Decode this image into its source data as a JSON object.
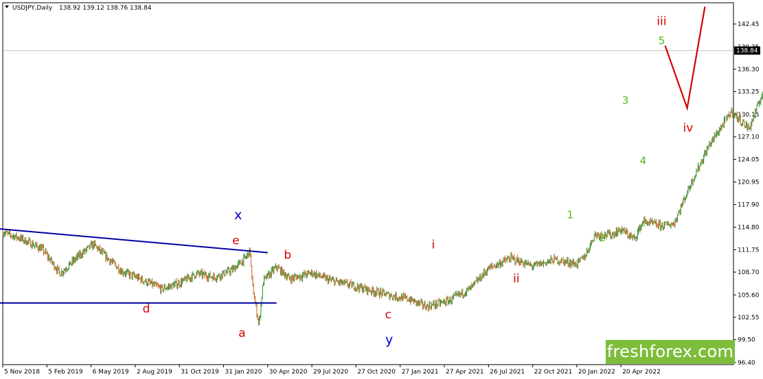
{
  "header": {
    "symbol": "USDJPY,Daily",
    "ohlc": "138.92 139.12 138.76 138.84"
  },
  "brand": {
    "text": "freshforex.com",
    "color": "#7dbd3b"
  },
  "colors": {
    "bull_candle": "#2e8b2e",
    "bear_candle": "#c8641e",
    "trendline": "#0000a0",
    "forecast": "#d40000",
    "wave_red": "#d40000",
    "wave_blue": "#0000c8",
    "wave_green": "#4cbb17",
    "price_line": "#c0c0c0"
  },
  "chart_data": {
    "type": "line",
    "title": "USDJPY,Daily",
    "xlabel": "",
    "ylabel": "",
    "ylim": [
      95.5,
      145.0
    ],
    "grid": false,
    "y_ticks": [
      "142.45",
      "139.35",
      "136.30",
      "133.25",
      "130.15",
      "127.10",
      "124.05",
      "120.95",
      "117.90",
      "114.80",
      "111.75",
      "108.70",
      "105.60",
      "102.55",
      "99.50",
      "96.40"
    ],
    "x_ticks": [
      "5 Nov 2018",
      "5 Feb 2019",
      "6 May 2019",
      "2 Aug 2019",
      "31 Oct 2019",
      "31 Jan 2020",
      "30 Apr 2020",
      "29 Jul 2020",
      "27 Oct 2020",
      "27 Jan 2021",
      "27 Apr 2021",
      "26 Jul 2021",
      "22 Oct 2021",
      "20 Jan 2022",
      "20 Apr 2022"
    ],
    "current_price": {
      "value": 138.84,
      "label": "138.84"
    },
    "series": [
      {
        "values_t": [
          0,
          0.4,
          0.9,
          1.3,
          1.7,
          2.05,
          2.3,
          2.7,
          3.1,
          3.6,
          4.0,
          4.4,
          4.8,
          5.2,
          5.5,
          5.6,
          5.65,
          5.8,
          5.9,
          6.2,
          6.5,
          7.0,
          7.4,
          7.9,
          8.4,
          8.8,
          9.2,
          9.6,
          10.1,
          10.6,
          11.0,
          11.5,
          12.0,
          12.5,
          13.0,
          13.2,
          13.4,
          13.8,
          14.0,
          14.3,
          14.5,
          14.9,
          15.2,
          15.6,
          16.0,
          16.5,
          16.9,
          17.3,
          17.7,
          18.1,
          18.4
        ],
        "values_price": [
          114.1,
          113.3,
          111.8,
          108.5,
          110.8,
          112.5,
          111.0,
          108.8,
          107.8,
          106.4,
          107.2,
          108.5,
          108.0,
          109.0,
          110.6,
          111.7,
          107.0,
          101.5,
          107.5,
          109.4,
          107.8,
          108.6,
          107.6,
          106.9,
          106.1,
          105.5,
          105.0,
          104.0,
          104.8,
          106.5,
          109.2,
          110.6,
          109.5,
          110.4,
          109.8,
          111.0,
          113.8,
          113.8,
          114.5,
          113.2,
          115.6,
          115.0,
          115.3,
          121.0,
          126.0,
          130.5,
          128.2,
          134.5,
          136.2,
          138.0,
          138.84
        ]
      }
    ],
    "trendlines": [
      {
        "t1": -0.1,
        "p1": 114.6,
        "t2": 6.0,
        "p2": 111.35
      },
      {
        "t1": -0.1,
        "p1": 104.5,
        "t2": 6.2,
        "p2": 104.5
      }
    ],
    "forecast_path": [
      {
        "t": 15.0,
        "p": 139.5
      },
      {
        "t": 15.5,
        "p": 131.0
      },
      {
        "t": 15.9,
        "p": 144.8
      }
    ],
    "annotations": [
      {
        "text": "x",
        "t": 5.33,
        "p": 115.9,
        "color": "wave_blue",
        "size": 19
      },
      {
        "text": "y",
        "t": 8.75,
        "p": 98.9,
        "color": "wave_blue",
        "size": 19
      },
      {
        "text": "e",
        "t": 5.28,
        "p": 112.5,
        "color": "wave_red",
        "size": 17
      },
      {
        "text": "a",
        "t": 5.42,
        "p": 99.9,
        "color": "wave_red",
        "size": 17
      },
      {
        "text": "b",
        "t": 6.45,
        "p": 110.5,
        "color": "wave_red",
        "size": 17
      },
      {
        "text": "c",
        "t": 8.73,
        "p": 102.4,
        "color": "wave_red",
        "size": 17
      },
      {
        "text": "d",
        "t": 3.25,
        "p": 103.2,
        "color": "wave_red",
        "size": 17
      },
      {
        "text": "i",
        "t": 9.75,
        "p": 111.9,
        "color": "wave_red",
        "size": 17
      },
      {
        "text": "ii",
        "t": 11.63,
        "p": 107.3,
        "color": "wave_red",
        "size": 17
      },
      {
        "text": "iii",
        "t": 14.92,
        "p": 142.3,
        "color": "wave_red",
        "size": 17
      },
      {
        "text": "iv",
        "t": 15.52,
        "p": 127.8,
        "color": "wave_red",
        "size": 17
      },
      {
        "text": "1",
        "t": 12.85,
        "p": 116.0,
        "color": "wave_green",
        "size": 15
      },
      {
        "text": "2",
        "t": 13.58,
        "p": 112.9,
        "color": "wave_green",
        "size": 15
      },
      {
        "text": "3",
        "t": 14.1,
        "p": 131.6,
        "color": "wave_green",
        "size": 15
      },
      {
        "text": "4",
        "t": 14.5,
        "p": 123.4,
        "color": "wave_green",
        "size": 15
      },
      {
        "text": "5",
        "t": 14.92,
        "p": 139.7,
        "color": "wave_green",
        "size": 15
      }
    ]
  }
}
